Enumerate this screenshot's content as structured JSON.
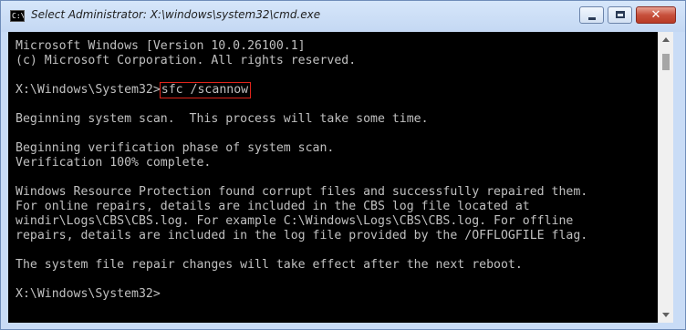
{
  "window": {
    "title": "Select Administrator: X:\\windows\\system32\\cmd.exe",
    "icon_text": "C:\\",
    "icon_name": "cmd-icon"
  },
  "controls": {
    "minimize_icon": "minimize-icon",
    "maximize_icon": "maximize-icon",
    "close_icon": "close-icon",
    "close_glyph": "✕"
  },
  "console": {
    "header_1": "Microsoft Windows [Version 10.0.26100.1]",
    "header_2": "(c) Microsoft Corporation. All rights reserved.",
    "prompt_1": "X:\\Windows\\System32>",
    "command": "sfc /scannow",
    "out_1": "Beginning system scan.  This process will take some time.",
    "out_2": "Beginning verification phase of system scan.",
    "out_3": "Verification 100% complete.",
    "out_4": "Windows Resource Protection found corrupt files and successfully repaired them.",
    "out_5": "For online repairs, details are included in the CBS log file located at",
    "out_6": "windir\\Logs\\CBS\\CBS.log. For example C:\\Windows\\Logs\\CBS\\CBS.log. For offline",
    "out_7": "repairs, details are included in the log file provided by the /OFFLOGFILE flag.",
    "out_8": "The system file repair changes will take effect after the next reboot.",
    "prompt_2": "X:\\Windows\\System32>"
  },
  "colors": {
    "console_bg": "#000000",
    "console_text": "#c0c0c0",
    "highlight_border": "#e0241b",
    "window_frame": "#c9dcf6"
  }
}
